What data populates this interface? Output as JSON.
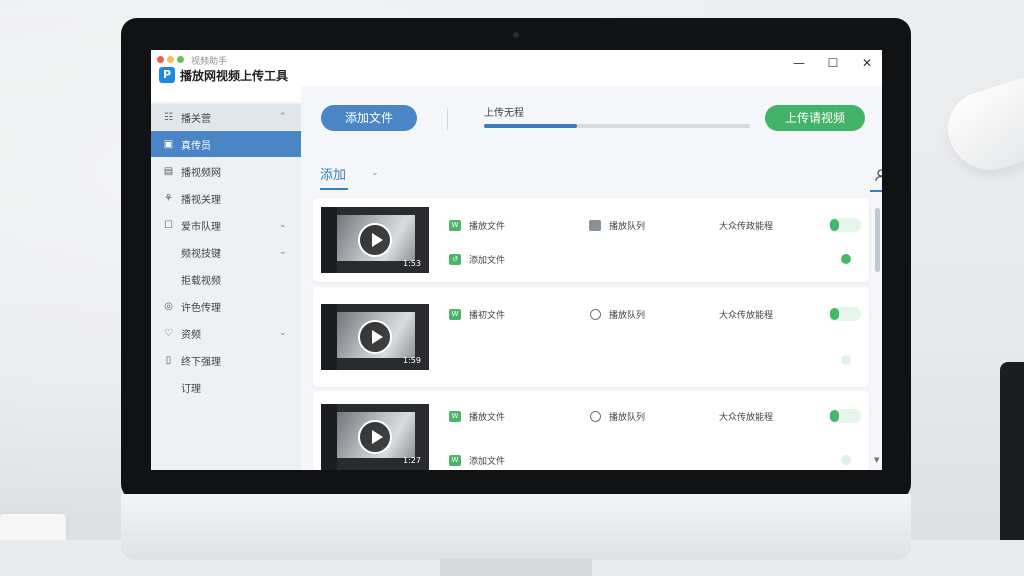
{
  "window": {
    "subtitle": "视频助手",
    "title": "播放网视频上传工具",
    "logo_letter": "P",
    "controls": {
      "minimize": "—",
      "maximize": "☐",
      "close": "✕"
    }
  },
  "sidebar": {
    "items": [
      {
        "icon": "☷",
        "label": "播关营",
        "chevron": "⌃"
      },
      {
        "icon": "▣",
        "label": "真传员",
        "chevron": ""
      },
      {
        "icon": "▤",
        "label": "播视频网",
        "chevron": ""
      },
      {
        "icon": "⚘",
        "label": "播视关理",
        "chevron": ""
      },
      {
        "icon": "☐",
        "label": "爱市队理",
        "chevron": "⌄"
      },
      {
        "icon": "",
        "label": "频视技键",
        "chevron": "⌄"
      },
      {
        "icon": "",
        "label": "拒载视频",
        "chevron": ""
      },
      {
        "icon": "◎",
        "label": "许色传理",
        "chevron": ""
      },
      {
        "icon": "♡",
        "label": "资频",
        "chevron": "⌄"
      },
      {
        "icon": "▯",
        "label": "终下强理",
        "chevron": ""
      },
      {
        "icon": "",
        "label": "订理",
        "chevron": ""
      }
    ]
  },
  "toolbar": {
    "add_file_label": "添加文件",
    "progress_label": "上传无程",
    "progress_percent": 35,
    "upload_button_label": "上传请视频"
  },
  "tabs": {
    "add_label": "添加",
    "chevron": "⌄",
    "icons": [
      "user-icon",
      "minus-icon",
      "download-icon",
      "gear-icon"
    ]
  },
  "cards": [
    {
      "duration": "1:53",
      "file_label": "播放文件",
      "folder_label": "播放队列",
      "status_label": "大众传政能程",
      "extra_label": "添加文件",
      "toggle_on": true,
      "dot_on": true
    },
    {
      "duration": "1:59",
      "file_label": "播初文件",
      "folder_label": "播放队列",
      "status_label": "大众传放能程",
      "extra_label": "",
      "toggle_on": true,
      "dot_on": false
    },
    {
      "duration": "1:27",
      "file_label": "播放文件",
      "folder_label": "播放队列",
      "status_label": "大众传放能程",
      "extra_label": "添加文件",
      "toggle_on": true,
      "dot_on": false
    }
  ],
  "colors": {
    "accent_blue": "#4a86c5",
    "accent_green": "#43b36a",
    "sidebar_bg": "#eef1f4"
  }
}
